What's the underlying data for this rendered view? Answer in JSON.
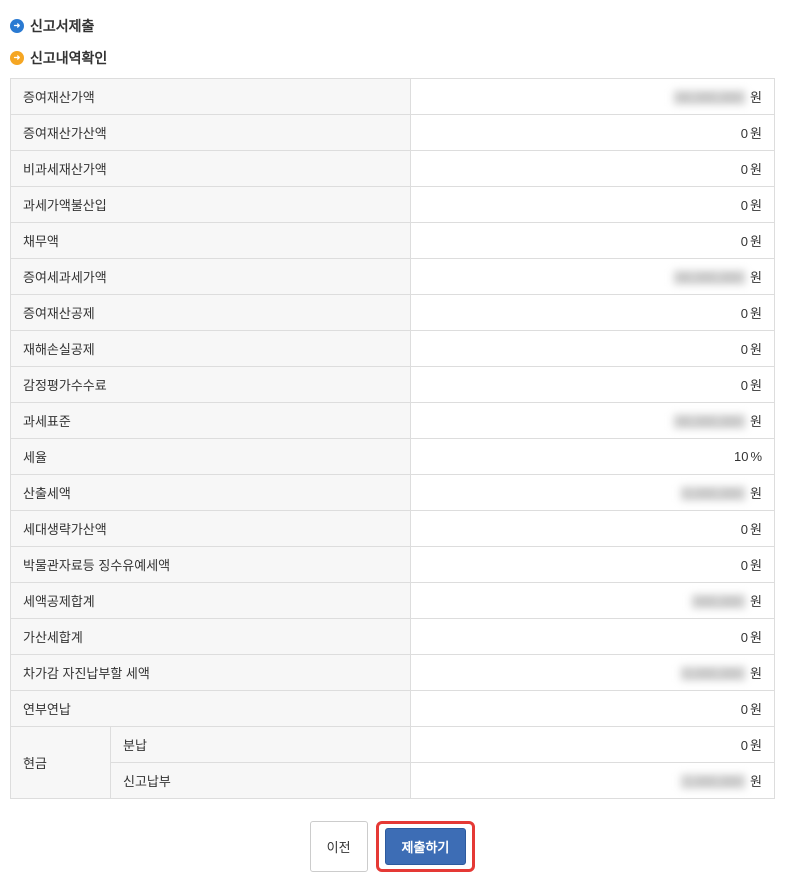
{
  "sections": {
    "submit": "신고서제출",
    "history": "신고내역확인"
  },
  "rows": [
    {
      "label": "증여재산가액",
      "value": "00,000,000",
      "unit": "원",
      "blurred": true
    },
    {
      "label": "증여재산가산액",
      "value": "0",
      "unit": "원",
      "blurred": false
    },
    {
      "label": "비과세재산가액",
      "value": "0",
      "unit": "원",
      "blurred": false
    },
    {
      "label": "과세가액불산입",
      "value": "0",
      "unit": "원",
      "blurred": false
    },
    {
      "label": "채무액",
      "value": "0",
      "unit": "원",
      "blurred": false
    },
    {
      "label": "증여세과세가액",
      "value": "00,000,000",
      "unit": "원",
      "blurred": true
    },
    {
      "label": "증여재산공제",
      "value": "0",
      "unit": "원",
      "blurred": false
    },
    {
      "label": "재해손실공제",
      "value": "0",
      "unit": "원",
      "blurred": false
    },
    {
      "label": "감정평가수수료",
      "value": "0",
      "unit": "원",
      "blurred": false
    },
    {
      "label": "과세표준",
      "value": "00,000,000",
      "unit": "원",
      "blurred": true
    },
    {
      "label": "세율",
      "value": "10",
      "unit": "%",
      "blurred": false
    },
    {
      "label": "산출세액",
      "value": "0,000,000",
      "unit": "원",
      "blurred": true
    },
    {
      "label": "세대생략가산액",
      "value": "0",
      "unit": "원",
      "blurred": false
    },
    {
      "label": "박물관자료등 징수유예세액",
      "value": "0",
      "unit": "원",
      "blurred": false
    },
    {
      "label": "세액공제합계",
      "value": "000,000",
      "unit": "원",
      "blurred": true
    },
    {
      "label": "가산세합계",
      "value": "0",
      "unit": "원",
      "blurred": false
    },
    {
      "label": "차가감 자진납부할 세액",
      "value": "0,000,000",
      "unit": "원",
      "blurred": true
    },
    {
      "label": "연부연납",
      "value": "0",
      "unit": "원",
      "blurred": false
    }
  ],
  "cash": {
    "label": "현금",
    "sub": [
      {
        "label": "분납",
        "value": "0",
        "unit": "원",
        "blurred": false
      },
      {
        "label": "신고납부",
        "value": "2,000,000",
        "unit": "원",
        "blurred": true
      }
    ]
  },
  "buttons": {
    "prev": "이전",
    "submit": "제출하기"
  }
}
